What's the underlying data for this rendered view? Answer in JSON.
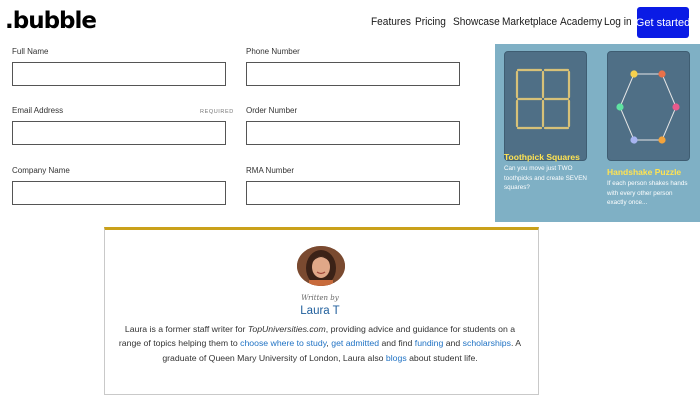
{
  "header": {
    "logo": ".bubble",
    "nav": [
      "Features",
      "Pricing",
      "Showcase",
      "Marketplace",
      "Academy"
    ],
    "login": "Log in",
    "cta": "Get started",
    "cta_color": "#0a1be5"
  },
  "form": {
    "full_name_label": "Full Name",
    "phone_label": "Phone Number",
    "email_label": "Email Address",
    "email_required": "REQUIRED",
    "order_label": "Order Number",
    "company_label": "Company Name",
    "rma_label": "RMA Number"
  },
  "puzzles": {
    "panel_color": "#7fb0c5",
    "items": [
      {
        "title": "Toothpick Squares",
        "desc": "Can you move just TWO toothpicks and create SEVEN squares?",
        "icon": "toothpick-grid-icon"
      },
      {
        "title": "Handshake Puzzle",
        "desc": "If each person shakes hands with every other person exactly once...",
        "icon": "hexagon-people-icon"
      }
    ]
  },
  "author": {
    "written_by": "Written by",
    "name": "Laura T",
    "bio": {
      "t1": "Laura is a former staff writer for ",
      "site": "TopUniversities.com",
      "t2": ", providing advice and guidance for students on a range of topics helping them to ",
      "link1": "choose where to study",
      "t3": ", ",
      "link2": "get admitted",
      "t4": " and find ",
      "link3": "funding",
      "t5": " and ",
      "link4": "scholarships",
      "t6": ". A graduate of Queen Mary University of London, Laura also ",
      "link5": "blogs",
      "t7": " about student life."
    },
    "link_color": "#1f72c4"
  }
}
